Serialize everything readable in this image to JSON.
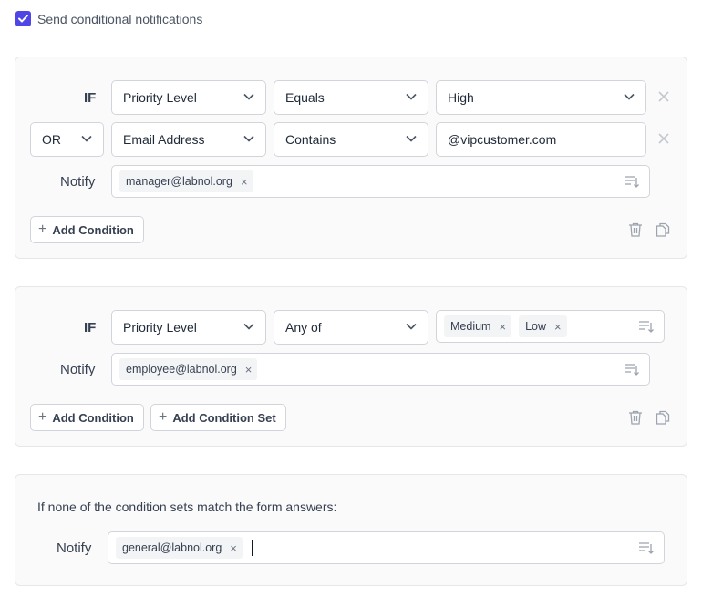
{
  "top": {
    "checkbox_label": "Send conditional notifications",
    "checked": true
  },
  "set1": {
    "if_label": "IF",
    "row1": {
      "field": "Priority Level",
      "operator": "Equals",
      "value": "High"
    },
    "row2": {
      "connector": "OR",
      "field": "Email Address",
      "operator": "Contains",
      "value": "@vipcustomer.com"
    },
    "notify_label": "Notify",
    "notify_tags": [
      "manager@labnol.org"
    ],
    "add_condition": "Add Condition"
  },
  "set2": {
    "if_label": "IF",
    "row1": {
      "field": "Priority Level",
      "operator": "Any of",
      "value_tags": [
        "Medium",
        "Low"
      ]
    },
    "notify_label": "Notify",
    "notify_tags": [
      "employee@labnol.org"
    ],
    "add_condition": "Add Condition",
    "add_condition_set": "Add Condition Set"
  },
  "fallback": {
    "text": "If none of the condition sets match the form answers:",
    "notify_label": "Notify",
    "notify_tags": [
      "general@labnol.org"
    ]
  },
  "colors": {
    "accent": "#4f46e5",
    "border": "#d1d5db",
    "card_bg": "#fafafa"
  },
  "icons": [
    "check-icon",
    "chevron-down-icon",
    "close-icon",
    "list-sort-icon",
    "trash-icon",
    "copy-icon",
    "plus-icon"
  ]
}
